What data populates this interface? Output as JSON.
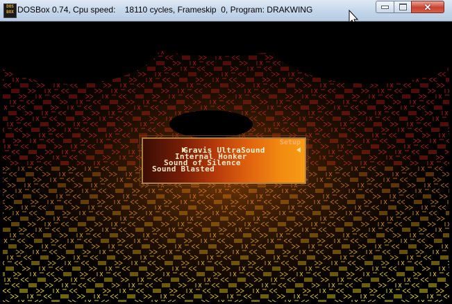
{
  "window": {
    "title": "DOSBox 0.74, Cpu speed:    18110 cycles, Frameskip  0, Program: DRAKWING",
    "icon_label": "DOS BOX",
    "controls": {
      "minimize": "minimize-icon",
      "maximize": "maximize-icon",
      "close": "close-icon"
    }
  },
  "game": {
    "menu": {
      "title": "Setup",
      "items": [
        "Gravis UltraSound",
        "Internal Honker",
        "Sound of Silence",
        "Sound Blasted"
      ],
      "selected_index": 0
    },
    "colors": {
      "fire_dark": "#5a0f04",
      "fire_mid": "#c04010",
      "fire_bright": "#f08a10",
      "pattern_top": "#b0101a",
      "pattern_bottom": "#d8d018"
    }
  }
}
